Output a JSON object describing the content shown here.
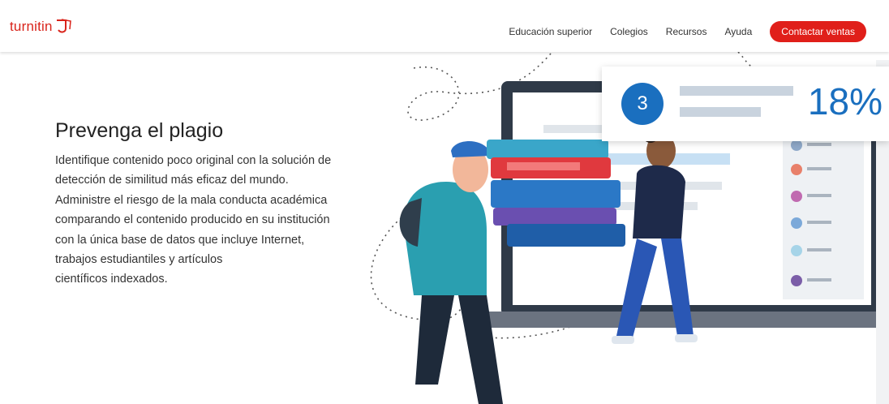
{
  "header": {
    "logo_text": "turnitin",
    "nav": [
      {
        "label": "Educación superior"
      },
      {
        "label": "Colegios"
      },
      {
        "label": "Recursos"
      },
      {
        "label": "Ayuda"
      }
    ],
    "cta_label": "Contactar ventas"
  },
  "hero": {
    "title": "Prevenga el plagio",
    "body": "Identifique contenido poco original con la solución de\ndetección de similitud más eficaz del mundo.\nAdministre el riesgo de la mala conducta académica\ncomparando el contenido producido en su institución\ncon la única base de datos que incluye Internet,\ntrabajos estudiantiles y artículos\ncientíficos indexados."
  },
  "stat_card": {
    "number": "3",
    "percent": "18%"
  },
  "colors": {
    "brand_red": "#e01f1a",
    "accent_blue": "#1a6fbf"
  }
}
